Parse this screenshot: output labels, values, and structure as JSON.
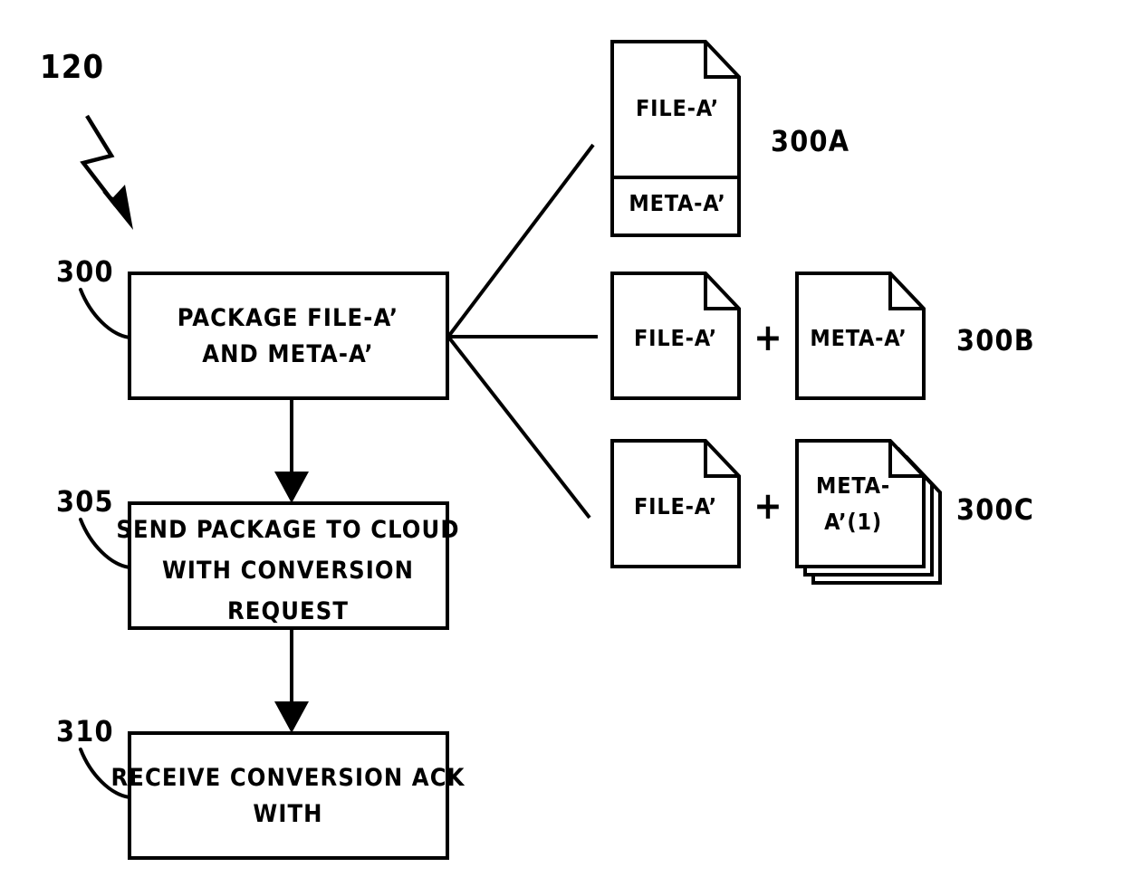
{
  "figure": {
    "figure_ref": "120",
    "process_steps": [
      {
        "ref": "300",
        "lines": [
          "PACKAGE FILE-A’",
          "AND META-A’"
        ]
      },
      {
        "ref": "305",
        "lines": [
          "SEND PACKAGE TO CLOUD",
          "WITH CONVERSION",
          "REQUEST"
        ]
      },
      {
        "ref": "310",
        "lines": [
          "RECEIVE CONVERSION ACK",
          "WITH"
        ]
      }
    ],
    "package_options": [
      {
        "ref": "300A",
        "style": "single-document-two-sections",
        "sections": [
          "FILE-A’",
          "META-A’"
        ],
        "operator": "",
        "stacked": false
      },
      {
        "ref": "300B",
        "style": "two-separate-documents",
        "sections": [
          "FILE-A’",
          "META-A’"
        ],
        "operator": "+",
        "stacked": false
      },
      {
        "ref": "300C",
        "style": "document-plus-document-stack",
        "sections": [
          "FILE-A’",
          "META-\nA’(1)"
        ],
        "doc_c_file_label": "FILE-A’",
        "doc_c_meta_line1": "META-",
        "doc_c_meta_line2": "A’(1)",
        "operator": "+",
        "stacked": true,
        "stack_count": 3
      }
    ],
    "colors": {
      "ink": "#000000",
      "paper": "#ffffff"
    }
  }
}
